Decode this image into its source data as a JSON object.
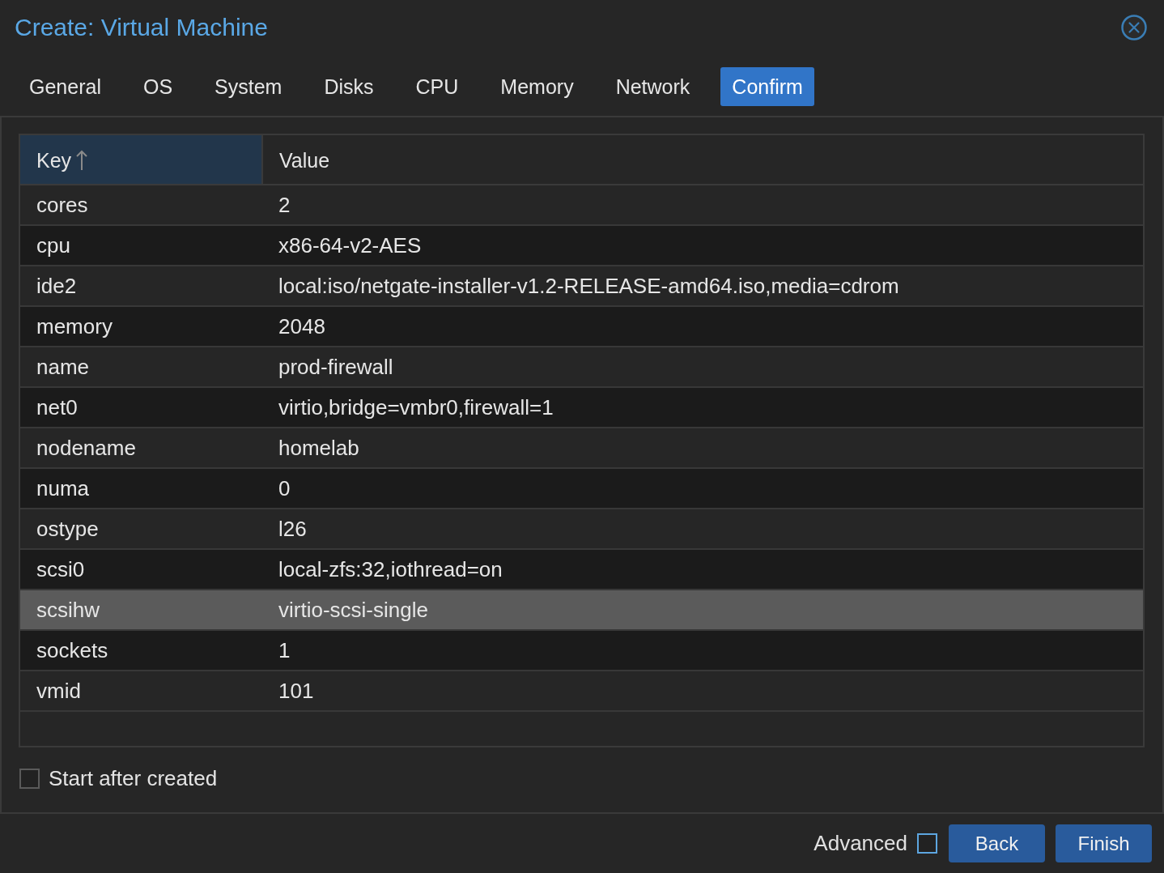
{
  "window": {
    "title": "Create: Virtual Machine"
  },
  "tabs": [
    {
      "label": "General",
      "selected": false
    },
    {
      "label": "OS",
      "selected": false
    },
    {
      "label": "System",
      "selected": false
    },
    {
      "label": "Disks",
      "selected": false
    },
    {
      "label": "CPU",
      "selected": false
    },
    {
      "label": "Memory",
      "selected": false
    },
    {
      "label": "Network",
      "selected": false
    },
    {
      "label": "Confirm",
      "selected": true
    }
  ],
  "table": {
    "columns": [
      {
        "label": "Key",
        "sorted": true
      },
      {
        "label": "Value",
        "sorted": false
      }
    ],
    "rows": [
      {
        "key": "cores",
        "value": "2",
        "selected": false
      },
      {
        "key": "cpu",
        "value": "x86-64-v2-AES",
        "selected": false
      },
      {
        "key": "ide2",
        "value": "local:iso/netgate-installer-v1.2-RELEASE-amd64.iso,media=cdrom",
        "selected": false
      },
      {
        "key": "memory",
        "value": "2048",
        "selected": false
      },
      {
        "key": "name",
        "value": "prod-firewall",
        "selected": false
      },
      {
        "key": "net0",
        "value": "virtio,bridge=vmbr0,firewall=1",
        "selected": false
      },
      {
        "key": "nodename",
        "value": "homelab",
        "selected": false
      },
      {
        "key": "numa",
        "value": "0",
        "selected": false
      },
      {
        "key": "ostype",
        "value": "l26",
        "selected": false
      },
      {
        "key": "scsi0",
        "value": "local-zfs:32,iothread=on",
        "selected": false
      },
      {
        "key": "scsihw",
        "value": "virtio-scsi-single",
        "selected": true
      },
      {
        "key": "sockets",
        "value": "1",
        "selected": false
      },
      {
        "key": "vmid",
        "value": "101",
        "selected": false
      }
    ]
  },
  "start_after_created": {
    "label": "Start after created",
    "checked": false
  },
  "footer": {
    "advanced": {
      "label": "Advanced",
      "checked": false,
      "focused": true
    },
    "buttons": [
      "Back",
      "Finish"
    ]
  }
}
